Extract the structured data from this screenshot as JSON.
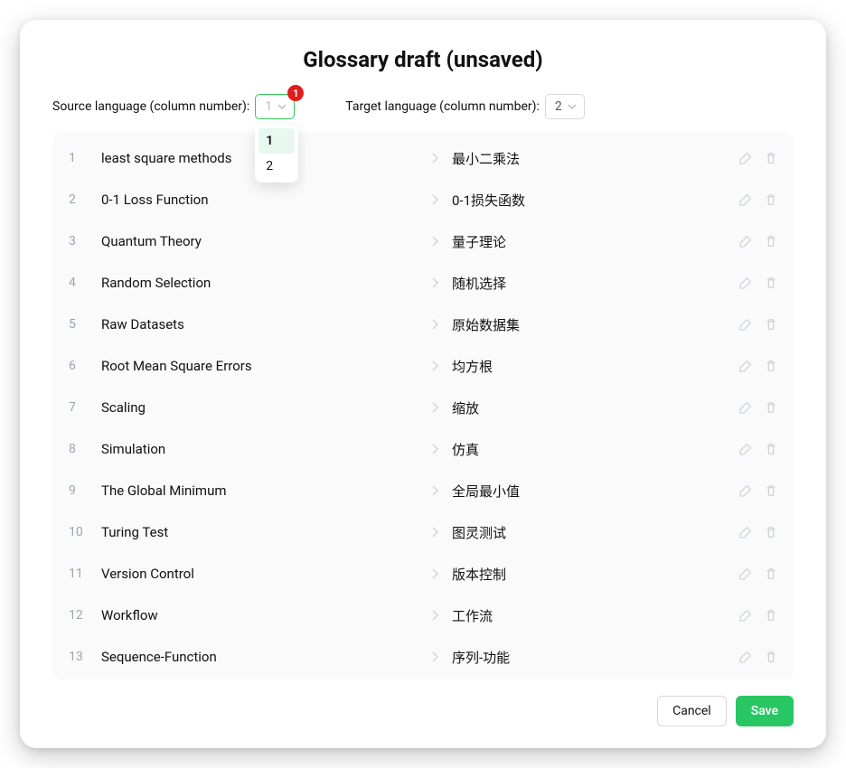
{
  "title": "Glossary draft (unsaved)",
  "source": {
    "label": "Source language (column number):",
    "value": "1",
    "badge": "1",
    "options": [
      "1",
      "2"
    ]
  },
  "target": {
    "label": "Target language (column number):",
    "value": "2"
  },
  "rows": [
    {
      "idx": "1",
      "src": "least square methods",
      "tgt": "最小二乘法"
    },
    {
      "idx": "2",
      "src": "0-1 Loss Function",
      "tgt": "0-1损失函数"
    },
    {
      "idx": "3",
      "src": "Quantum Theory",
      "tgt": "量子理论"
    },
    {
      "idx": "4",
      "src": "Random Selection",
      "tgt": "随机选择"
    },
    {
      "idx": "5",
      "src": "Raw Datasets",
      "tgt": "原始数据集"
    },
    {
      "idx": "6",
      "src": "Root Mean Square Errors",
      "tgt": "均方根"
    },
    {
      "idx": "7",
      "src": "Scaling",
      "tgt": "缩放"
    },
    {
      "idx": "8",
      "src": "Simulation",
      "tgt": "仿真"
    },
    {
      "idx": "9",
      "src": "The Global Minimum",
      "tgt": "全局最小值"
    },
    {
      "idx": "10",
      "src": "Turing Test",
      "tgt": "图灵测试"
    },
    {
      "idx": "11",
      "src": "Version Control",
      "tgt": "版本控制"
    },
    {
      "idx": "12",
      "src": "Workflow",
      "tgt": "工作流"
    },
    {
      "idx": "13",
      "src": "Sequence-Function",
      "tgt": "序列-功能"
    }
  ],
  "buttons": {
    "cancel": "Cancel",
    "save": "Save"
  }
}
